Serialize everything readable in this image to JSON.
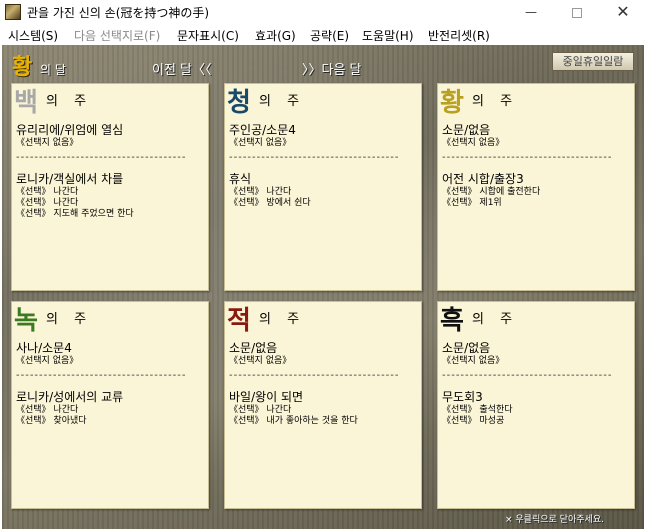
{
  "window": {
    "title": "관을 가진 신의 손(冠を持つ神の手)",
    "minimize_glyph": "—",
    "close_glyph": "✕"
  },
  "menu": [
    {
      "label": "시스템(S)",
      "enabled": true
    },
    {
      "label": "다음 선택지로(F)",
      "enabled": false
    },
    {
      "label": "문자표시(C)",
      "enabled": true
    },
    {
      "label": "효과(G)",
      "enabled": true
    },
    {
      "label": "공략(E)",
      "enabled": true
    },
    {
      "label": "도움말(H)",
      "enabled": true
    },
    {
      "label": "반전리셋(R)",
      "enabled": true
    }
  ],
  "header": {
    "month_char": "황",
    "month_suffix": "의 달",
    "prev_label": "이전 달〈〈",
    "next_label": "〉〉다음 달",
    "holiday_button": "중일휴일일람"
  },
  "week_suffix": "의 주",
  "cards": [
    {
      "week_char": "백",
      "color": "#a8a8a8",
      "events": [
        {
          "title": "유리리에/위엄에 열심",
          "lines": [
            "《선택지 없음》"
          ]
        },
        {
          "title": "로니카/객실에서 차를",
          "lines": [
            "《선택》 나간다",
            "《선택》 나간다",
            "《선택》 지도해 주었으면 한다"
          ]
        }
      ]
    },
    {
      "week_char": "청",
      "color": "#1a4a6a",
      "events": [
        {
          "title": "주인공/소문4",
          "lines": [
            "《선택지 없음》"
          ]
        },
        {
          "title": "휴식",
          "lines": [
            "《선택》 나간다",
            "《선택》 방에서 쉰다"
          ]
        }
      ]
    },
    {
      "week_char": "황",
      "color": "#b8a020",
      "events": [
        {
          "title": "소문/없음",
          "lines": [
            "《선택지 없음》"
          ]
        },
        {
          "title": "어전 시합/출장3",
          "lines": [
            "《선택》 시합에 출전한다",
            "《선택》 제1위"
          ]
        }
      ]
    },
    {
      "week_char": "녹",
      "color": "#3a7a20",
      "events": [
        {
          "title": "사나/소문4",
          "lines": [
            "《선택지 없음》"
          ]
        },
        {
          "title": "로니카/성에서의 교류",
          "lines": [
            "《선택》 나간다",
            "《선택》 찾아냈다"
          ]
        }
      ]
    },
    {
      "week_char": "적",
      "color": "#8a1a10",
      "events": [
        {
          "title": "소문/없음",
          "lines": [
            "《선택지 없음》"
          ]
        },
        {
          "title": "바일/왕이 되면",
          "lines": [
            "《선택》 나간다",
            "《선택》 내가 좋아하는 것을 한다"
          ]
        }
      ]
    },
    {
      "week_char": "흑",
      "color": "#101010",
      "events": [
        {
          "title": "소문/없음",
          "lines": [
            "《선택지 없음》"
          ]
        },
        {
          "title": "무도회3",
          "lines": [
            "《선택》 출석한다",
            "《선택》 마성공"
          ]
        }
      ]
    }
  ],
  "footnote": "× 우클릭으로 닫아주세요."
}
